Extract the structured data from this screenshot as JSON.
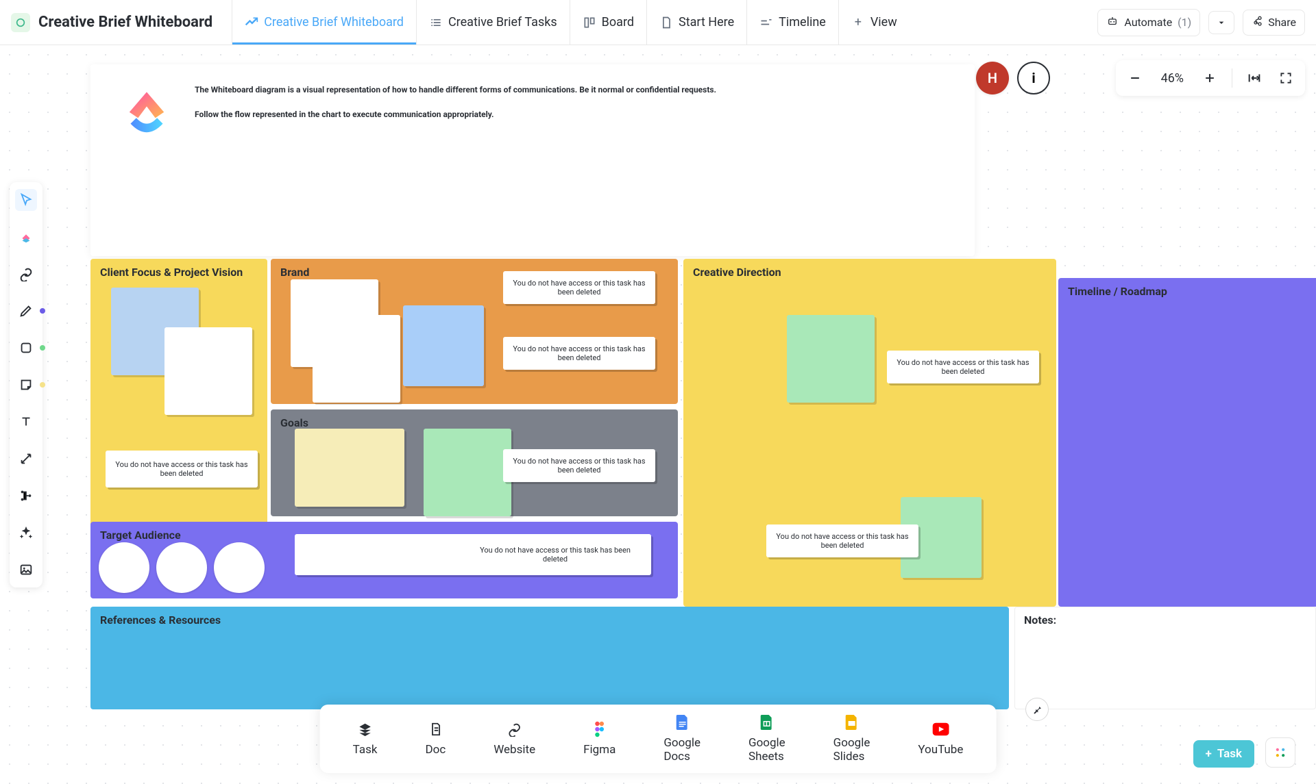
{
  "header": {
    "title": "Creative Brief Whiteboard",
    "tabs": [
      {
        "label": "Creative Brief Whiteboard",
        "icon": "whiteboard-icon",
        "active": true
      },
      {
        "label": "Creative Brief Tasks",
        "icon": "list-icon"
      },
      {
        "label": "Board",
        "icon": "board-icon"
      },
      {
        "label": "Start Here",
        "icon": "doc-icon"
      },
      {
        "label": "Timeline",
        "icon": "timeline-icon"
      },
      {
        "label": "View",
        "icon": "plus-icon"
      }
    ],
    "automate_label": "Automate",
    "automate_count": "(1)",
    "share_label": "Share"
  },
  "controls": {
    "avatar_initial": "H",
    "zoom": "46%"
  },
  "whiteboard_header": {
    "line1": "The Whiteboard diagram is a visual representation of how to handle different forms of communications. Be it normal or confidential requests.",
    "line2": "Follow the flow represented in the chart to execute communication appropriately."
  },
  "sections": {
    "client_focus": "Client Focus & Project Vision",
    "brand": "Brand",
    "goals": "Goals",
    "target_audience": "Target Audience",
    "creative_direction": "Creative Direction",
    "timeline_roadmap": "Timeline / Roadmap",
    "references": "References & Resources",
    "notes": "Notes:"
  },
  "no_access_text": "You do not have access or this task has been deleted",
  "dock": {
    "items": [
      {
        "label": "Task"
      },
      {
        "label": "Doc"
      },
      {
        "label": "Website"
      },
      {
        "label": "Figma"
      },
      {
        "label": "Google Docs"
      },
      {
        "label": "Google Sheets"
      },
      {
        "label": "Google Slides"
      },
      {
        "label": "YouTube"
      }
    ]
  },
  "fab": {
    "task_label": "Task"
  }
}
